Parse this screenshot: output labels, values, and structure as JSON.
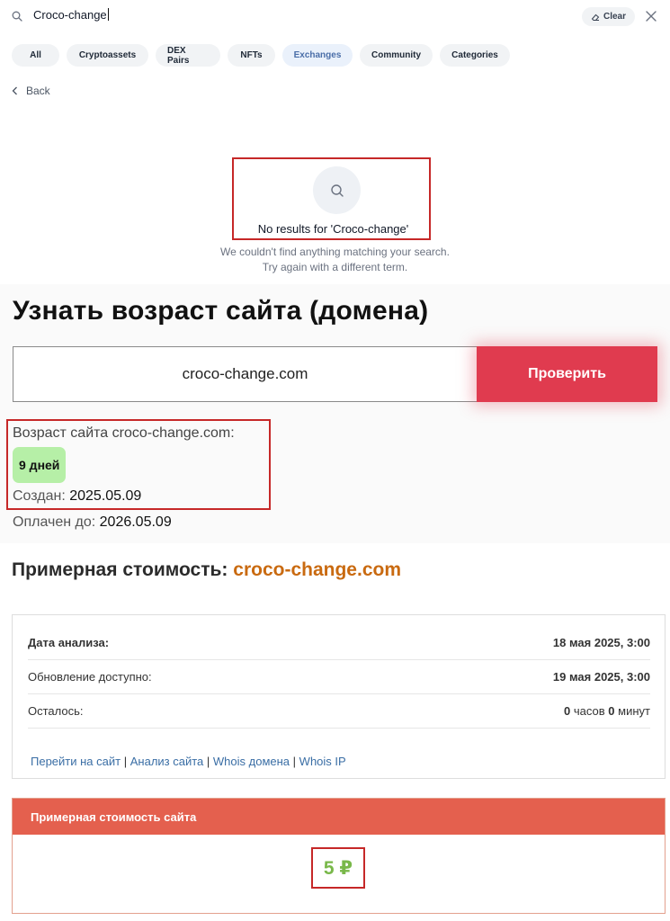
{
  "search": {
    "query": "Croco-change",
    "clear_label": "Clear"
  },
  "tabs": [
    {
      "label": "All"
    },
    {
      "label": "Cryptoassets"
    },
    {
      "label": "DEX Pairs"
    },
    {
      "label": "NFTs"
    },
    {
      "label": "Exchanges"
    },
    {
      "label": "Community"
    },
    {
      "label": "Categories"
    }
  ],
  "active_tab": "Exchanges",
  "back_label": "Back",
  "no_results": {
    "title": "No results for 'Croco-change'",
    "line1": "We couldn't find anything matching your search.",
    "line2": "Try again with a different term."
  },
  "age_checker": {
    "title": "Узнать возраст сайта (домена)",
    "domain_value": "croco-change.com",
    "button_label": "Проверить",
    "age_label": "Возраст сайта croco-change.com:",
    "age_value": "9 дней",
    "created_label": "Создан:",
    "created_value": "2025.05.09",
    "paid_label": "Оплачен до:",
    "paid_value": "2026.05.09"
  },
  "estimate": {
    "title_prefix": "Примерная стоимость:",
    "domain": "croco-change.com",
    "rows": [
      {
        "label": "Дата анализа:",
        "value": "18 мая 2025, 3:00"
      },
      {
        "label": "Обновление доступно:",
        "value": "19 мая 2025, 3:00"
      },
      {
        "label": "Осталось:",
        "value_num1": "0",
        "value_unit1": "часов",
        "value_num2": "0",
        "value_unit2": "минут"
      }
    ],
    "links": [
      "Перейти на сайт",
      "Анализ сайта",
      "Whois домена",
      "Whois IP"
    ],
    "separator": "|",
    "price_header": "Примерная стоимость сайта",
    "price_value": "5 ₽"
  },
  "colors": {
    "highlight_red": "#c62828",
    "button_red": "#e03b4f",
    "domain_orange": "#c96a10",
    "price_green": "#79b84a",
    "header_coral": "#e4604e",
    "badge_green": "#b6efa7",
    "link_blue": "#3a6ea5"
  }
}
